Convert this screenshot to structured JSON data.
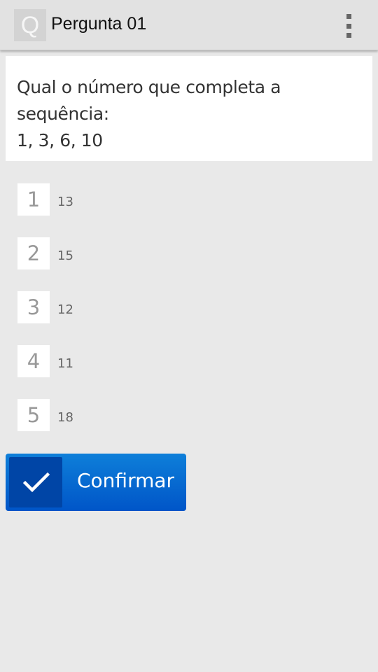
{
  "app_bar": {
    "icon_letter": "Q",
    "title": "Pergunta 01",
    "menu_icon": "overflow-menu-icon"
  },
  "question": {
    "text": "Qual o número que completa a sequência:\n1, 3, 6, 10"
  },
  "options": [
    {
      "number": "1",
      "value": "13"
    },
    {
      "number": "2",
      "value": "15"
    },
    {
      "number": "3",
      "value": "12"
    },
    {
      "number": "4",
      "value": "11"
    },
    {
      "number": "5",
      "value": "18"
    }
  ],
  "confirm": {
    "label": "Confirmar",
    "icon": "checkmark-icon"
  },
  "colors": {
    "accent_blue": "#0a6fd6",
    "background": "#e9e9e9"
  }
}
